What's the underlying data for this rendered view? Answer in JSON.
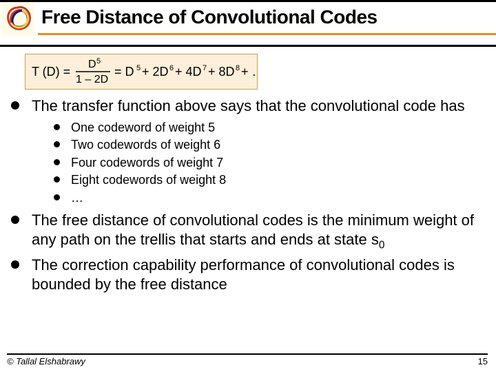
{
  "title": "Free Distance of Convolutional Codes",
  "formula": {
    "lhs_var": "T",
    "lhs_arg": "D",
    "numer_base": "D",
    "numer_exp": "5",
    "denom": "1 – 2D",
    "rhs_terms": [
      {
        "coef_before": "= D",
        "exp": "5"
      },
      {
        "coef_before": " + 2D",
        "exp": "6"
      },
      {
        "coef_before": " + 4D",
        "exp": "7"
      },
      {
        "coef_before": " + 8D",
        "exp": "8"
      },
      {
        "coef_before": " + …",
        "exp": ""
      }
    ]
  },
  "bullets": [
    {
      "text": "The transfer function above says that the convolutional code has",
      "sub": [
        "One codeword of weight 5",
        "Two codewords of weight 6",
        "Four codewords of weight 7",
        "Eight codewords of weight 8",
        "…"
      ]
    },
    {
      "text_html": "The free distance of convolutional codes is the minimum weight of any path on the trellis that starts and ends at state s",
      "subscript": "0"
    },
    {
      "text_html": "The correction capability performance of convolutional codes is bounded by the free distance"
    }
  ],
  "footer": {
    "copyright": "© Tallal Elshabrawy",
    "page": "15"
  },
  "colors": {
    "accent_orange": "#e88b1a",
    "formula_bg": "#fdefd9"
  }
}
